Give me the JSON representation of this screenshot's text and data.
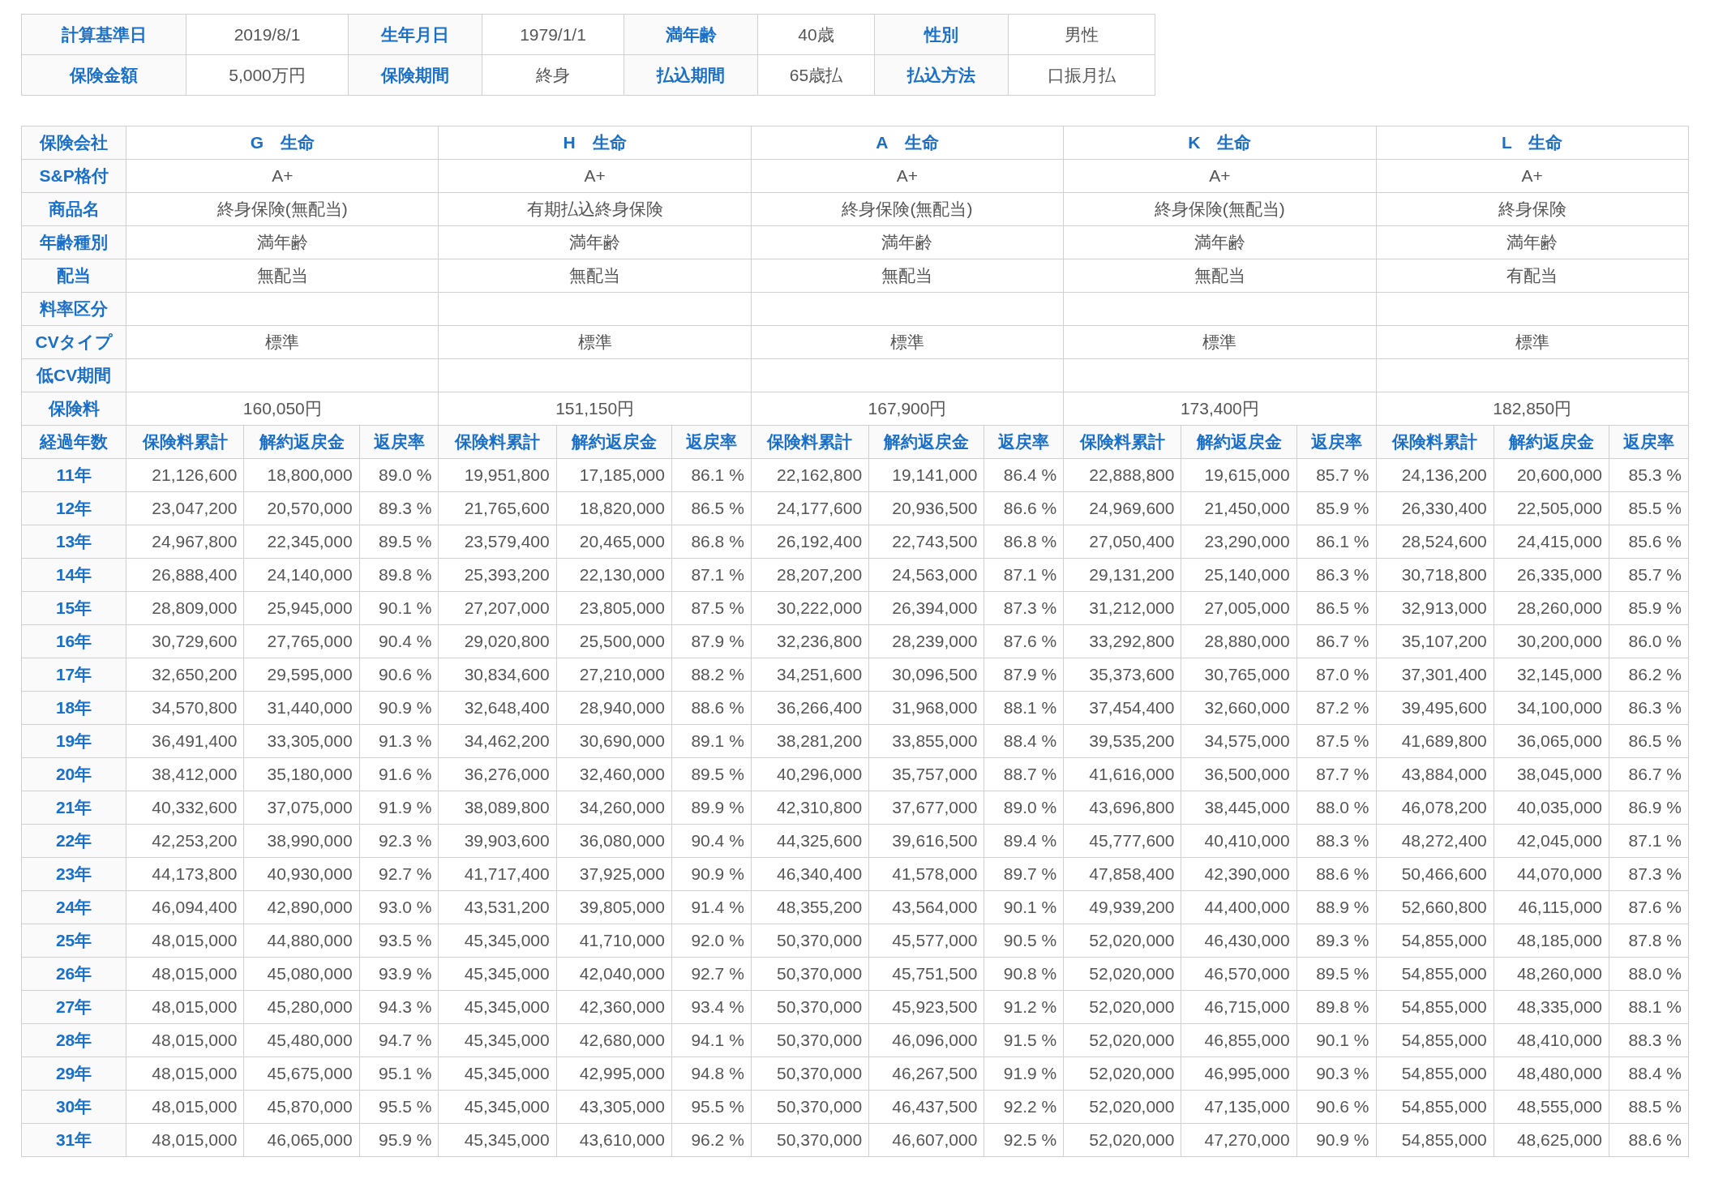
{
  "summary": [
    [
      {
        "label": "計算基準日",
        "value": "2019/8/1"
      },
      {
        "label": "生年月日",
        "value": "1979/1/1"
      },
      {
        "label": "満年齢",
        "value": "40歳"
      },
      {
        "label": "性別",
        "value": "男性"
      }
    ],
    [
      {
        "label": "保険金額",
        "value": "5,000万円"
      },
      {
        "label": "保険期間",
        "value": "終身"
      },
      {
        "label": "払込期間",
        "value": "65歳払"
      },
      {
        "label": "払込方法",
        "value": "口振月払"
      }
    ]
  ],
  "comparison": {
    "company_label": "保険会社",
    "companies": [
      "G　生命",
      "H　生命",
      "A　生命",
      "K　生命",
      "L　生命"
    ],
    "attribute_rows": [
      {
        "label": "S&P格付",
        "values": [
          "A+",
          "A+",
          "A+",
          "A+",
          "A+"
        ]
      },
      {
        "label": "商品名",
        "values": [
          "終身保険(無配当)",
          "有期払込終身保険",
          "終身保険(無配当)",
          "終身保険(無配当)",
          "終身保険"
        ]
      },
      {
        "label": "年齢種別",
        "values": [
          "満年齢",
          "満年齢",
          "満年齢",
          "満年齢",
          "満年齢"
        ]
      },
      {
        "label": "配当",
        "values": [
          "無配当",
          "無配当",
          "無配当",
          "無配当",
          "有配当"
        ]
      },
      {
        "label": "料率区分"
      },
      {
        "label": "CVタイプ",
        "values": [
          "標準",
          "標準",
          "標準",
          "標準",
          "標準"
        ]
      },
      {
        "label": "低CV期間"
      },
      {
        "label": "保険料",
        "values": [
          "160,050円",
          "151,150円",
          "167,900円",
          "173,400円",
          "182,850円"
        ]
      }
    ],
    "year_label": "経過年数",
    "column_headers": [
      "保険料累計",
      "解約返戻金",
      "返戻率",
      "保険料累計",
      "解約返戻金",
      "返戻率",
      "保険料累計",
      "解約返戻金",
      "返戻率",
      "保険料累計",
      "解約返戻金",
      "返戻率",
      "保険料累計",
      "解約返戻金",
      "返戻率"
    ],
    "rows": [
      {
        "year": "11年",
        "cells": [
          "21,126,600",
          "18,800,000",
          "89.0 %",
          "19,951,800",
          "17,185,000",
          "86.1 %",
          "22,162,800",
          "19,141,000",
          "86.4 %",
          "22,888,800",
          "19,615,000",
          "85.7 %",
          "24,136,200",
          "20,600,000",
          "85.3 %"
        ]
      },
      {
        "year": "12年",
        "cells": [
          "23,047,200",
          "20,570,000",
          "89.3 %",
          "21,765,600",
          "18,820,000",
          "86.5 %",
          "24,177,600",
          "20,936,500",
          "86.6 %",
          "24,969,600",
          "21,450,000",
          "85.9 %",
          "26,330,400",
          "22,505,000",
          "85.5 %"
        ]
      },
      {
        "year": "13年",
        "cells": [
          "24,967,800",
          "22,345,000",
          "89.5 %",
          "23,579,400",
          "20,465,000",
          "86.8 %",
          "26,192,400",
          "22,743,500",
          "86.8 %",
          "27,050,400",
          "23,290,000",
          "86.1 %",
          "28,524,600",
          "24,415,000",
          "85.6 %"
        ]
      },
      {
        "year": "14年",
        "cells": [
          "26,888,400",
          "24,140,000",
          "89.8 %",
          "25,393,200",
          "22,130,000",
          "87.1 %",
          "28,207,200",
          "24,563,000",
          "87.1 %",
          "29,131,200",
          "25,140,000",
          "86.3 %",
          "30,718,800",
          "26,335,000",
          "85.7 %"
        ]
      },
      {
        "year": "15年",
        "cells": [
          "28,809,000",
          "25,945,000",
          "90.1 %",
          "27,207,000",
          "23,805,000",
          "87.5 %",
          "30,222,000",
          "26,394,000",
          "87.3 %",
          "31,212,000",
          "27,005,000",
          "86.5 %",
          "32,913,000",
          "28,260,000",
          "85.9 %"
        ]
      },
      {
        "year": "16年",
        "cells": [
          "30,729,600",
          "27,765,000",
          "90.4 %",
          "29,020,800",
          "25,500,000",
          "87.9 %",
          "32,236,800",
          "28,239,000",
          "87.6 %",
          "33,292,800",
          "28,880,000",
          "86.7 %",
          "35,107,200",
          "30,200,000",
          "86.0 %"
        ]
      },
      {
        "year": "17年",
        "cells": [
          "32,650,200",
          "29,595,000",
          "90.6 %",
          "30,834,600",
          "27,210,000",
          "88.2 %",
          "34,251,600",
          "30,096,500",
          "87.9 %",
          "35,373,600",
          "30,765,000",
          "87.0 %",
          "37,301,400",
          "32,145,000",
          "86.2 %"
        ]
      },
      {
        "year": "18年",
        "cells": [
          "34,570,800",
          "31,440,000",
          "90.9 %",
          "32,648,400",
          "28,940,000",
          "88.6 %",
          "36,266,400",
          "31,968,000",
          "88.1 %",
          "37,454,400",
          "32,660,000",
          "87.2 %",
          "39,495,600",
          "34,100,000",
          "86.3 %"
        ]
      },
      {
        "year": "19年",
        "cells": [
          "36,491,400",
          "33,305,000",
          "91.3 %",
          "34,462,200",
          "30,690,000",
          "89.1 %",
          "38,281,200",
          "33,855,000",
          "88.4 %",
          "39,535,200",
          "34,575,000",
          "87.5 %",
          "41,689,800",
          "36,065,000",
          "86.5 %"
        ]
      },
      {
        "year": "20年",
        "cells": [
          "38,412,000",
          "35,180,000",
          "91.6 %",
          "36,276,000",
          "32,460,000",
          "89.5 %",
          "40,296,000",
          "35,757,000",
          "88.7 %",
          "41,616,000",
          "36,500,000",
          "87.7 %",
          "43,884,000",
          "38,045,000",
          "86.7 %"
        ]
      },
      {
        "year": "21年",
        "cells": [
          "40,332,600",
          "37,075,000",
          "91.9 %",
          "38,089,800",
          "34,260,000",
          "89.9 %",
          "42,310,800",
          "37,677,000",
          "89.0 %",
          "43,696,800",
          "38,445,000",
          "88.0 %",
          "46,078,200",
          "40,035,000",
          "86.9 %"
        ]
      },
      {
        "year": "22年",
        "cells": [
          "42,253,200",
          "38,990,000",
          "92.3 %",
          "39,903,600",
          "36,080,000",
          "90.4 %",
          "44,325,600",
          "39,616,500",
          "89.4 %",
          "45,777,600",
          "40,410,000",
          "88.3 %",
          "48,272,400",
          "42,045,000",
          "87.1 %"
        ]
      },
      {
        "year": "23年",
        "cells": [
          "44,173,800",
          "40,930,000",
          "92.7 %",
          "41,717,400",
          "37,925,000",
          "90.9 %",
          "46,340,400",
          "41,578,000",
          "89.7 %",
          "47,858,400",
          "42,390,000",
          "88.6 %",
          "50,466,600",
          "44,070,000",
          "87.3 %"
        ]
      },
      {
        "year": "24年",
        "cells": [
          "46,094,400",
          "42,890,000",
          "93.0 %",
          "43,531,200",
          "39,805,000",
          "91.4 %",
          "48,355,200",
          "43,564,000",
          "90.1 %",
          "49,939,200",
          "44,400,000",
          "88.9 %",
          "52,660,800",
          "46,115,000",
          "87.6 %"
        ]
      },
      {
        "year": "25年",
        "cells": [
          "48,015,000",
          "44,880,000",
          "93.5 %",
          "45,345,000",
          "41,710,000",
          "92.0 %",
          "50,370,000",
          "45,577,000",
          "90.5 %",
          "52,020,000",
          "46,430,000",
          "89.3 %",
          "54,855,000",
          "48,185,000",
          "87.8 %"
        ]
      },
      {
        "year": "26年",
        "cells": [
          "48,015,000",
          "45,080,000",
          "93.9 %",
          "45,345,000",
          "42,040,000",
          "92.7 %",
          "50,370,000",
          "45,751,500",
          "90.8 %",
          "52,020,000",
          "46,570,000",
          "89.5 %",
          "54,855,000",
          "48,260,000",
          "88.0 %"
        ]
      },
      {
        "year": "27年",
        "cells": [
          "48,015,000",
          "45,280,000",
          "94.3 %",
          "45,345,000",
          "42,360,000",
          "93.4 %",
          "50,370,000",
          "45,923,500",
          "91.2 %",
          "52,020,000",
          "46,715,000",
          "89.8 %",
          "54,855,000",
          "48,335,000",
          "88.1 %"
        ]
      },
      {
        "year": "28年",
        "cells": [
          "48,015,000",
          "45,480,000",
          "94.7 %",
          "45,345,000",
          "42,680,000",
          "94.1 %",
          "50,370,000",
          "46,096,000",
          "91.5 %",
          "52,020,000",
          "46,855,000",
          "90.1 %",
          "54,855,000",
          "48,410,000",
          "88.3 %"
        ]
      },
      {
        "year": "29年",
        "cells": [
          "48,015,000",
          "45,675,000",
          "95.1 %",
          "45,345,000",
          "42,995,000",
          "94.8 %",
          "50,370,000",
          "46,267,500",
          "91.9 %",
          "52,020,000",
          "46,995,000",
          "90.3 %",
          "54,855,000",
          "48,480,000",
          "88.4 %"
        ]
      },
      {
        "year": "30年",
        "cells": [
          "48,015,000",
          "45,870,000",
          "95.5 %",
          "45,345,000",
          "43,305,000",
          "95.5 %",
          "50,370,000",
          "46,437,500",
          "92.2 %",
          "52,020,000",
          "47,135,000",
          "90.6 %",
          "54,855,000",
          "48,555,000",
          "88.5 %"
        ]
      },
      {
        "year": "31年",
        "cells": [
          "48,015,000",
          "46,065,000",
          "95.9 %",
          "45,345,000",
          "43,610,000",
          "96.2 %",
          "50,370,000",
          "46,607,000",
          "92.5 %",
          "52,020,000",
          "47,270,000",
          "90.9 %",
          "54,855,000",
          "48,625,000",
          "88.6 %"
        ]
      }
    ]
  }
}
